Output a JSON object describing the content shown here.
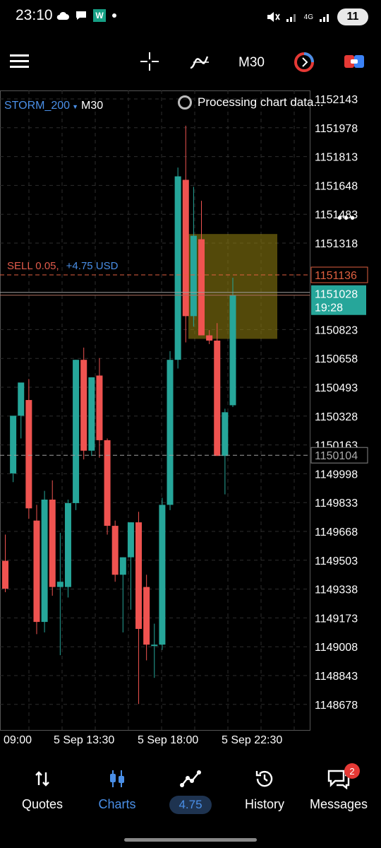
{
  "status_bar": {
    "time": "23:10",
    "w_badge": "W",
    "signal_label": "4G",
    "battery": "11",
    "icons": [
      "cloud-icon",
      "chat-icon",
      "w-app-icon",
      "dot-icon",
      "mute-icon",
      "signal-icon",
      "battery-icon"
    ]
  },
  "toolbar": {
    "timeframe": "M30",
    "icons": [
      "menu-icon",
      "crosshair-icon",
      "indicators-icon",
      "objects-icon",
      "trade-icon"
    ]
  },
  "chart": {
    "symbol": "STORM_200",
    "timeframe": "M30",
    "processing_text": "Processing chart data...",
    "position": {
      "side_volume": "SELL 0.05,",
      "profit": "+4.75 USD"
    },
    "colors": {
      "bull": "#26a69a",
      "bear": "#ef5350",
      "grid": "#2e2e2e",
      "sell_line": "#e06040",
      "ask_line": "#9e9e9e",
      "bid_label": "#26a69a",
      "box": "#8a7a10"
    }
  },
  "chart_data": {
    "type": "candlestick",
    "price_axis_labels": [
      "1152143",
      "1151978",
      "1151813",
      "1151648",
      "1151483",
      "1151318",
      "1151136",
      "1151028",
      "1150823",
      "1150658",
      "1150493",
      "1150328",
      "1150163",
      "1150104",
      "1149998",
      "1149833",
      "1149668",
      "1149503",
      "1149338",
      "1149173",
      "1149008",
      "1148843",
      "1148678"
    ],
    "time_axis_labels": [
      "09:00",
      "5 Sep 13:30",
      "5 Sep 18:00",
      "5 Sep 22:30"
    ],
    "current_bid": "1151028",
    "current_bid_time": "19:28",
    "sell_open_price": "1151136",
    "ask_line_price": "1150104",
    "candles": [
      {
        "o": 1149500,
        "h": 1149650,
        "l": 1149320,
        "c": 1149340
      },
      {
        "o": 1150000,
        "h": 1150230,
        "l": 1149950,
        "c": 1150330
      },
      {
        "o": 1150330,
        "h": 1150500,
        "l": 1150200,
        "c": 1150520
      },
      {
        "o": 1150420,
        "h": 1150540,
        "l": 1149740,
        "c": 1149800
      },
      {
        "o": 1149730,
        "h": 1149820,
        "l": 1149080,
        "c": 1149150
      },
      {
        "o": 1149150,
        "h": 1149900,
        "l": 1149090,
        "c": 1149850
      },
      {
        "o": 1149850,
        "h": 1149960,
        "l": 1149300,
        "c": 1149350
      },
      {
        "o": 1149350,
        "h": 1149660,
        "l": 1148960,
        "c": 1149380
      },
      {
        "o": 1149350,
        "h": 1149850,
        "l": 1149290,
        "c": 1149830
      },
      {
        "o": 1149830,
        "h": 1150650,
        "l": 1149790,
        "c": 1150650
      },
      {
        "o": 1150650,
        "h": 1150720,
        "l": 1150080,
        "c": 1150130
      },
      {
        "o": 1150130,
        "h": 1150550,
        "l": 1150100,
        "c": 1150550
      },
      {
        "o": 1150560,
        "h": 1150660,
        "l": 1150090,
        "c": 1150190
      },
      {
        "o": 1150190,
        "h": 1150200,
        "l": 1149650,
        "c": 1149700
      },
      {
        "o": 1149700,
        "h": 1149730,
        "l": 1149380,
        "c": 1149420
      },
      {
        "o": 1149420,
        "h": 1149520,
        "l": 1149090,
        "c": 1149520
      },
      {
        "o": 1149520,
        "h": 1149720,
        "l": 1149220,
        "c": 1149720
      },
      {
        "o": 1149720,
        "h": 1149780,
        "l": 1148680,
        "c": 1149110
      },
      {
        "o": 1149350,
        "h": 1149420,
        "l": 1148930,
        "c": 1149020
      },
      {
        "o": 1149020,
        "h": 1149140,
        "l": 1148830,
        "c": 1149020
      },
      {
        "o": 1149020,
        "h": 1149860,
        "l": 1148990,
        "c": 1149820
      },
      {
        "o": 1149820,
        "h": 1150700,
        "l": 1149790,
        "c": 1150650
      },
      {
        "o": 1150650,
        "h": 1151750,
        "l": 1150600,
        "c": 1151700
      },
      {
        "o": 1151680,
        "h": 1151990,
        "l": 1150750,
        "c": 1150900
      },
      {
        "o": 1150900,
        "h": 1151640,
        "l": 1150840,
        "c": 1151360
      },
      {
        "o": 1151340,
        "h": 1151560,
        "l": 1150800,
        "c": 1150790
      },
      {
        "o": 1150790,
        "h": 1150820,
        "l": 1150740,
        "c": 1150760
      },
      {
        "o": 1150760,
        "h": 1150860,
        "l": 1150370,
        "c": 1150100
      },
      {
        "o": 1150100,
        "h": 1150370,
        "l": 1149880,
        "c": 1150350
      },
      {
        "o": 1150390,
        "h": 1151120,
        "l": 1150380,
        "c": 1151020
      }
    ],
    "position_box": {
      "price_top": 1151370,
      "price_bottom": 1150770
    }
  },
  "bottom_nav": {
    "items": [
      {
        "label": "Quotes",
        "icon": "quotes-icon"
      },
      {
        "label": "Charts",
        "icon": "charts-icon"
      },
      {
        "label": "4.75",
        "icon": "trade-icon"
      },
      {
        "label": "History",
        "icon": "history-icon"
      },
      {
        "label": "Messages",
        "icon": "messages-icon"
      }
    ],
    "messages_badge": "2"
  }
}
